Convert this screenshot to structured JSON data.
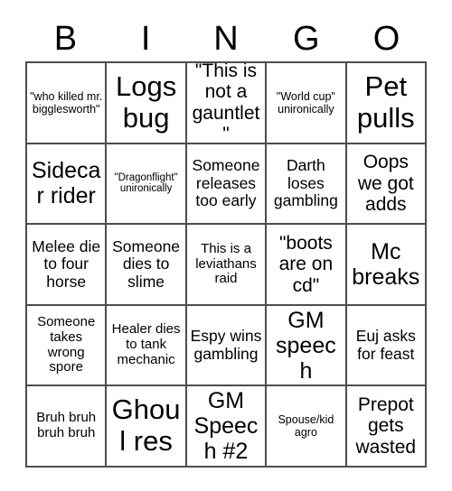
{
  "card": {
    "title": "BINGO",
    "header_letters": [
      "B",
      "I",
      "N",
      "G",
      "O"
    ],
    "columns": 5,
    "rows": 5,
    "colors": {
      "background": "#ffffff",
      "text": "#000000",
      "grid_line": "#4d4d4d"
    },
    "cells": [
      {
        "text": "\"who killed mr. bigglesworth\"",
        "size": "xs",
        "marked": false
      },
      {
        "text": "Logs bug",
        "size": "xxl",
        "marked": false
      },
      {
        "text": "\"This is not a gauntlet\"",
        "size": "lg",
        "marked": false
      },
      {
        "text": "\"World cup\" unironically",
        "size": "xs",
        "marked": false
      },
      {
        "text": "Pet pulls",
        "size": "xxl",
        "marked": false
      },
      {
        "text": "Sidecar rider",
        "size": "xl",
        "marked": false
      },
      {
        "text": "\"Dragonflight\" unironically",
        "size": "xxs",
        "marked": false
      },
      {
        "text": "Someone releases too early",
        "size": "md",
        "marked": false
      },
      {
        "text": "Darth loses gambling",
        "size": "md",
        "marked": false
      },
      {
        "text": "Oops we got adds",
        "size": "lg",
        "marked": false
      },
      {
        "text": "Melee die to four horse",
        "size": "md",
        "marked": false
      },
      {
        "text": "Someone dies to slime",
        "size": "md",
        "marked": false
      },
      {
        "text": "This is a leviathans raid",
        "size": "sm",
        "marked": false
      },
      {
        "text": "\"boots are on cd\"",
        "size": "lg",
        "marked": false
      },
      {
        "text": "Mc breaks",
        "size": "xl",
        "marked": false
      },
      {
        "text": "Someone takes wrong spore",
        "size": "sm",
        "marked": false
      },
      {
        "text": "Healer dies to tank mechanic",
        "size": "sm",
        "marked": false
      },
      {
        "text": "Espy wins gambling",
        "size": "md",
        "marked": false
      },
      {
        "text": "GM speech",
        "size": "xl",
        "marked": false
      },
      {
        "text": "Euj asks for feast",
        "size": "md",
        "marked": false
      },
      {
        "text": "Bruh bruh bruh bruh",
        "size": "sm",
        "marked": false
      },
      {
        "text": "Ghoul res",
        "size": "xxl",
        "marked": false
      },
      {
        "text": "GM Speech #2",
        "size": "xl",
        "marked": false
      },
      {
        "text": "Spouse/kid agro",
        "size": "xs",
        "marked": false
      },
      {
        "text": "Prepot gets wasted",
        "size": "lg",
        "marked": false
      }
    ]
  }
}
